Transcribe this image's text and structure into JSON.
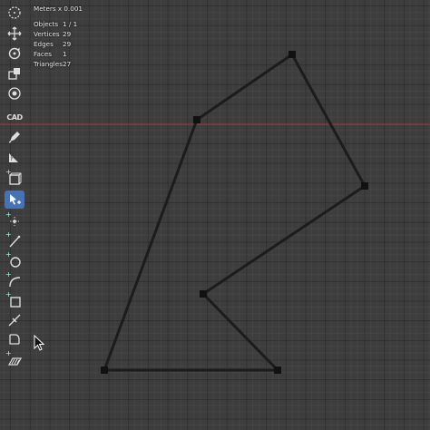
{
  "overlay": {
    "units": "Meters x 0.001",
    "stats": [
      {
        "label": "Objects",
        "value": "1 / 1"
      },
      {
        "label": "Vertices",
        "value": "29"
      },
      {
        "label": "Edges",
        "value": "29"
      },
      {
        "label": "Faces",
        "value": "1"
      },
      {
        "label": "Triangles",
        "value": "27"
      }
    ]
  },
  "toolbar": {
    "cad_label": "CAD",
    "tools": [
      {
        "name": "select-circle-tool",
        "icon": "dotted-circle-icon"
      },
      {
        "name": "move-tool",
        "icon": "move-arrows-icon"
      },
      {
        "name": "rotate-tool",
        "icon": "rotate-icon"
      },
      {
        "name": "scale-tool",
        "icon": "scale-icon"
      },
      {
        "name": "transform-tool",
        "icon": "transform-icon"
      },
      {
        "name": "cad-tool",
        "icon": "cad-icon"
      },
      {
        "name": "annotate-tool",
        "icon": "pencil-icon"
      },
      {
        "name": "measure-tool",
        "icon": "ruler-icon"
      },
      {
        "name": "add-cube-tool",
        "icon": "cube-icon"
      },
      {
        "name": "cursor-snap-tool",
        "icon": "cursor-snap-icon"
      },
      {
        "name": "add-point-tool",
        "icon": "point-icon"
      },
      {
        "name": "add-line-tool",
        "icon": "line-icon"
      },
      {
        "name": "add-circle-tool",
        "icon": "circle-icon"
      },
      {
        "name": "add-arc-tool",
        "icon": "arc-icon"
      },
      {
        "name": "add-rectangle-tool",
        "icon": "rectangle-icon"
      },
      {
        "name": "trim-tool",
        "icon": "trim-icon"
      },
      {
        "name": "fillet-tool",
        "icon": "fillet-icon"
      },
      {
        "name": "hatch-tool",
        "icon": "hatch-icon"
      }
    ],
    "active_tool": "cursor-snap-tool"
  },
  "colors": {
    "background": "#3d3d3d",
    "active_tool": "#4772b3",
    "x_axis": "#b43a3a",
    "edge": "#1c1c1c",
    "vertex": "#111111"
  }
}
